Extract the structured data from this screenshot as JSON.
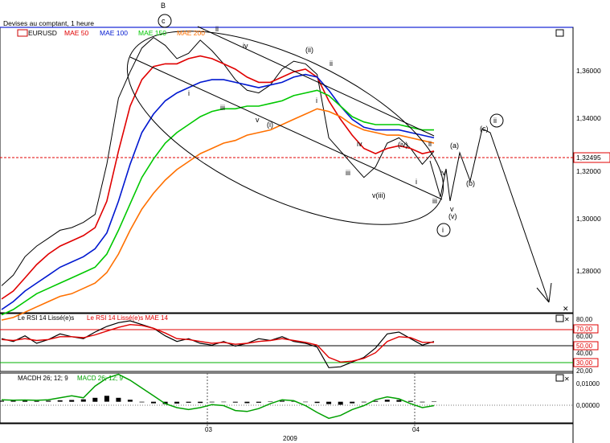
{
  "window": {
    "title": "Devises au comptant, 1 heure",
    "symbol": "EURUSD",
    "close_icon": "close-icon"
  },
  "main_panel": {
    "legend": [
      {
        "label": "EURUSD",
        "color": "#000000"
      },
      {
        "label": "MAE 50",
        "color": "#e00000"
      },
      {
        "label": "MAE 100",
        "color": "#0018d0"
      },
      {
        "label": "MAE 150",
        "color": "#00c800"
      },
      {
        "label": "MAE 200",
        "color": "#ff7000"
      }
    ],
    "current_price": "1,32495",
    "y_ticks": [
      "1,36000",
      "1,34000",
      "1,32000",
      "1,30000",
      "1,28000"
    ]
  },
  "rsi_panel": {
    "legend": [
      {
        "label": "Le RSI 14 Lissé(e)s",
        "color": "#000000"
      },
      {
        "label": "Le RSI 14 Lissé(e)s MAE 14",
        "color": "#e00000"
      }
    ],
    "y_ticks": [
      "80,00",
      "70,00",
      "60,00",
      "50,00",
      "40,00",
      "30,00",
      "20,00"
    ],
    "level_labels": [
      {
        "text": "70,00",
        "color": "#e00000"
      },
      {
        "text": "50,00",
        "color": "#e00000"
      },
      {
        "text": "30,00",
        "color": "#e00000"
      }
    ],
    "levels": {
      "overbought": 70,
      "mid": 50,
      "oversold": 30
    }
  },
  "macd_panel": {
    "legend": [
      {
        "label": "MACDH 26; 12; 9",
        "color": "#000000"
      },
      {
        "label": "MACD 26; 12; 9",
        "color": "#00a000"
      }
    ],
    "y_ticks": [
      "0,01000",
      "0,00000"
    ]
  },
  "x_axis": {
    "ticks": [
      "03",
      "04"
    ],
    "year": "2009"
  },
  "annotations": {
    "wave_labels": [
      "B",
      "c",
      "ii",
      "iv",
      "(ii)",
      "ii",
      "i",
      "iii",
      "v",
      "(i)",
      "i",
      "iv",
      "iii",
      "v(iii)",
      "(iv)",
      "ii",
      "iv",
      "i",
      "iii",
      "v",
      "(v)",
      "i",
      "(a)",
      "(b)",
      "(c)",
      "ii"
    ]
  },
  "chart_data": [
    {
      "type": "line",
      "title": "Devises au comptant, 1 heure",
      "series": [
        {
          "name": "EURUSD",
          "values": [
            1.274,
            1.278,
            1.285,
            1.289,
            1.292,
            1.295,
            1.296,
            1.298,
            1.301,
            1.32,
            1.345,
            1.355,
            1.364,
            1.368,
            1.365,
            1.36,
            1.362,
            1.367,
            1.363,
            1.358,
            1.352,
            1.348,
            1.347,
            1.35,
            1.356,
            1.359,
            1.358,
            1.354,
            1.33,
            1.325,
            1.32,
            1.315,
            1.319,
            1.328,
            1.33,
            1.326,
            1.32,
            1.3249
          ]
        },
        {
          "name": "MAE 50",
          "values": [
            1.269,
            1.272,
            1.277,
            1.282,
            1.286,
            1.289,
            1.291,
            1.293,
            1.296,
            1.306,
            1.325,
            1.342,
            1.352,
            1.357,
            1.358,
            1.358,
            1.36,
            1.361,
            1.36,
            1.358,
            1.356,
            1.353,
            1.351,
            1.351,
            1.353,
            1.355,
            1.356,
            1.353,
            1.344,
            1.337,
            1.331,
            1.326,
            1.324,
            1.326,
            1.327,
            1.326,
            1.324,
            1.325
          ]
        },
        {
          "name": "MAE 100",
          "values": [
            1.265,
            1.268,
            1.272,
            1.275,
            1.278,
            1.281,
            1.283,
            1.285,
            1.288,
            1.294,
            1.306,
            1.32,
            1.332,
            1.339,
            1.344,
            1.347,
            1.349,
            1.351,
            1.352,
            1.352,
            1.351,
            1.35,
            1.349,
            1.35,
            1.351,
            1.353,
            1.354,
            1.353,
            1.348,
            1.342,
            1.337,
            1.334,
            1.333,
            1.333,
            1.333,
            1.332,
            1.331,
            1.33
          ]
        },
        {
          "name": "MAE 150",
          "values": [
            1.263,
            1.265,
            1.268,
            1.271,
            1.273,
            1.275,
            1.277,
            1.279,
            1.281,
            1.286,
            1.295,
            1.305,
            1.315,
            1.322,
            1.328,
            1.332,
            1.335,
            1.338,
            1.34,
            1.341,
            1.341,
            1.342,
            1.342,
            1.343,
            1.344,
            1.346,
            1.347,
            1.348,
            1.346,
            1.342,
            1.338,
            1.336,
            1.335,
            1.335,
            1.335,
            1.334,
            1.333,
            1.333
          ]
        },
        {
          "name": "MAE 200",
          "values": [
            1.261,
            1.262,
            1.264,
            1.266,
            1.268,
            1.27,
            1.271,
            1.273,
            1.275,
            1.279,
            1.286,
            1.295,
            1.303,
            1.309,
            1.314,
            1.318,
            1.321,
            1.324,
            1.326,
            1.328,
            1.329,
            1.331,
            1.332,
            1.333,
            1.335,
            1.337,
            1.339,
            1.341,
            1.34,
            1.338,
            1.335,
            1.333,
            1.332,
            1.331,
            1.331,
            1.33,
            1.329,
            1.328
          ]
        }
      ],
      "ylim": [
        1.265,
        1.37
      ]
    },
    {
      "type": "line",
      "series": [
        {
          "name": "Le RSI 14 Lissé(e)s",
          "values": [
            55,
            52,
            58,
            50,
            54,
            60,
            57,
            55,
            62,
            68,
            72,
            74,
            70,
            66,
            58,
            52,
            55,
            50,
            48,
            52,
            47,
            50,
            55,
            53,
            57,
            52,
            50,
            46,
            24,
            25,
            30,
            35,
            45,
            60,
            62,
            55,
            48,
            52
          ]
        },
        {
          "name": "Le RSI 14 Lissé(e)s MAE 14",
          "values": [
            54,
            53,
            55,
            53,
            54,
            57,
            57,
            56,
            59,
            63,
            67,
            70,
            69,
            66,
            61,
            55,
            54,
            52,
            50,
            51,
            49,
            50,
            52,
            53,
            55,
            53,
            51,
            48,
            35,
            30,
            31,
            34,
            40,
            52,
            57,
            56,
            51,
            51
          ]
        }
      ],
      "ylim": [
        20,
        80
      ]
    },
    {
      "type": "line",
      "series": [
        {
          "name": "MACDH 26; 12; 9",
          "values": [
            0.0005,
            0.0008,
            0.0006,
            0.0004,
            0.0005,
            0.0007,
            0.0009,
            0.0012,
            0.002,
            0.003,
            0.002,
            0.001,
            -0.0003,
            -0.0008,
            -0.0012,
            -0.0009,
            -0.0005,
            -0.0006,
            -0.0003,
            -0.0002,
            -0.0004,
            -0.0007,
            -0.0005,
            0.0002,
            0.0005,
            0.0003,
            -0.0002,
            -0.0006,
            -0.0012,
            -0.0015,
            -0.0008,
            -0.0003,
            0.0004,
            0.001,
            0.0009,
            0.0004,
            -0.0003,
            0.0001
          ]
        },
        {
          "name": "MACD 26; 12; 9",
          "values": [
            0.001,
            0.0008,
            0.0009,
            0.0007,
            0.001,
            0.002,
            0.003,
            0.002,
            0.008,
            0.012,
            0.014,
            0.011,
            0.007,
            0.003,
            -0.001,
            -0.003,
            -0.004,
            -0.003,
            -0.0015,
            -0.002,
            -0.0045,
            -0.005,
            -0.0035,
            -0.001,
            0.001,
            0.0005,
            -0.002,
            -0.0055,
            -0.0085,
            -0.007,
            -0.004,
            -0.002,
            0.001,
            0.0025,
            0.0015,
            -0.001,
            -0.003,
            -0.002
          ]
        }
      ],
      "ylim": [
        -0.01,
        0.013
      ]
    }
  ]
}
